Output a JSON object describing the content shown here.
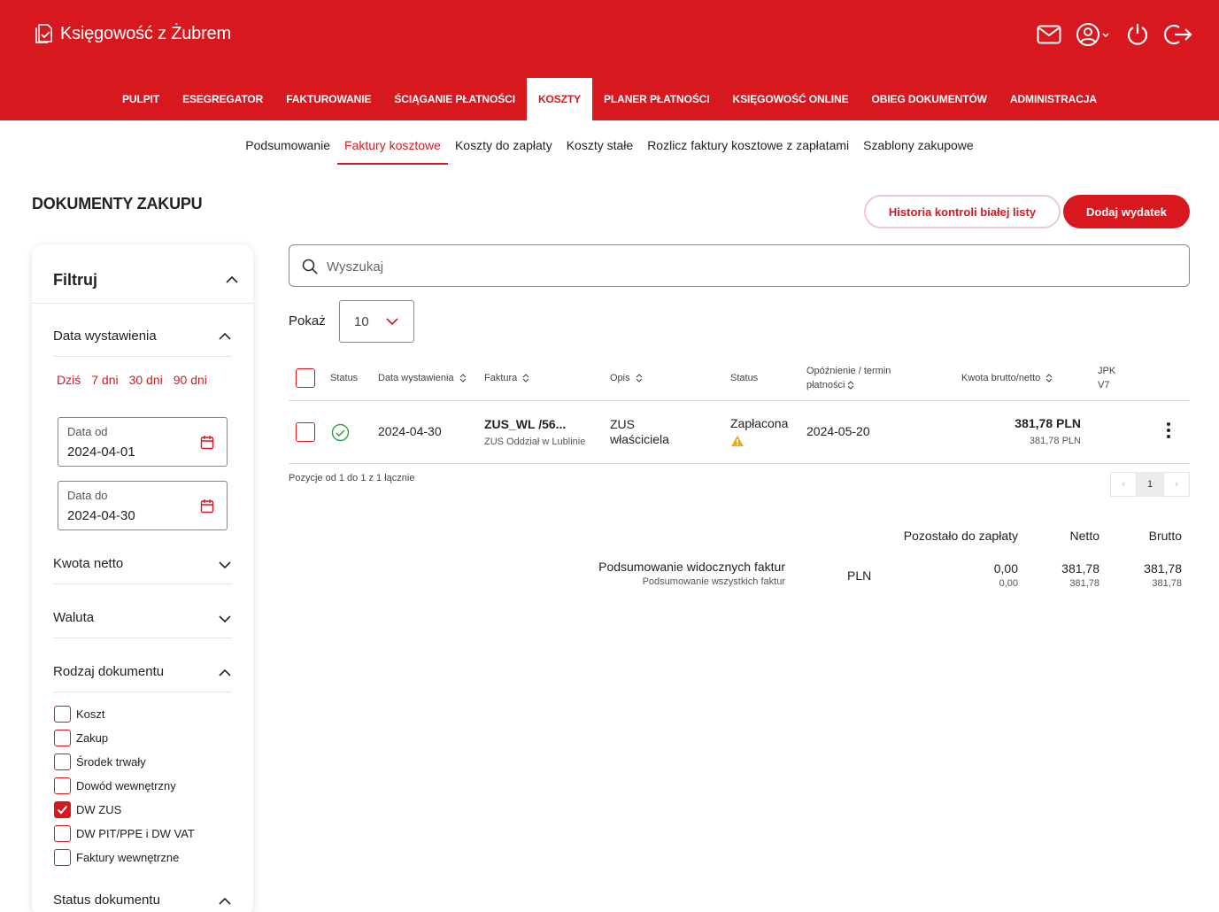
{
  "app": {
    "name": "Księgowość z Żubrem"
  },
  "header_icons": [
    "mail-icon",
    "user-icon",
    "power-icon",
    "logout-icon"
  ],
  "main_nav": [
    {
      "label": "PULPIT"
    },
    {
      "label": "ESEGREGATOR"
    },
    {
      "label": "FAKTUROWANIE"
    },
    {
      "label": "ŚCIĄGANIE PŁATNOŚCI"
    },
    {
      "label": "KOSZTY",
      "active": true
    },
    {
      "label": "PLANER PŁATNOŚCI"
    },
    {
      "label": "KSIĘGOWOŚĆ ONLINE"
    },
    {
      "label": "OBIEG DOKUMENTÓW"
    },
    {
      "label": "ADMINISTRACJA"
    }
  ],
  "sub_nav": [
    {
      "label": "Podsumowanie"
    },
    {
      "label": "Faktury kosztowe",
      "active": true
    },
    {
      "label": "Koszty do zapłaty"
    },
    {
      "label": "Koszty stałe"
    },
    {
      "label": "Rozlicz faktury kosztowe z zapłatami"
    },
    {
      "label": "Szablony zakupowe"
    }
  ],
  "page": {
    "title": "DOKUMENTY ZAKUPU",
    "btn_history": "Historia kontroli białej listy",
    "btn_add": "Dodaj wydatek"
  },
  "filter": {
    "title": "Filtruj",
    "date_section": "Data wystawienia",
    "quick": [
      "Dziś",
      "7 dni",
      "30 dni",
      "90 dni"
    ],
    "date_from_label": "Data od",
    "date_from": "2024-04-01",
    "date_to_label": "Data do",
    "date_to": "2024-04-30",
    "amount_section": "Kwota netto",
    "currency_section": "Waluta",
    "doctype_section": "Rodzaj dokumentu",
    "doctypes": [
      {
        "label": "Koszt",
        "checked": false
      },
      {
        "label": "Zakup",
        "checked": false
      },
      {
        "label": "Środek trwały",
        "checked": false
      },
      {
        "label": "Dowód wewnętrzny",
        "checked": false
      },
      {
        "label": "DW ZUS",
        "checked": true
      },
      {
        "label": "DW PIT/PPE i DW VAT",
        "checked": false
      },
      {
        "label": "Faktury wewnętrzne",
        "checked": false
      }
    ],
    "status_section": "Status dokumentu"
  },
  "search": {
    "placeholder": "Wyszukaj"
  },
  "page_size": {
    "label": "Pokaż",
    "value": "10"
  },
  "table": {
    "headers": {
      "status": "Status",
      "date": "Data wystawienia",
      "invoice": "Faktura",
      "desc": "Opis",
      "status2": "Status",
      "delay_1": "Opóźnienie / termin",
      "delay_2": "płatności",
      "amount": "Kwota brutto/netto",
      "jpk_1": "JPK",
      "jpk_2": "V7"
    },
    "rows": [
      {
        "date": "2024-04-30",
        "invoice": "ZUS_WL /56...",
        "issuer": "ZUS Oddział w Lublinie",
        "desc_1": "ZUS",
        "desc_2": "właściciela",
        "status": "Zapłacona",
        "due": "2024-05-20",
        "gross": "381,78 PLN",
        "net": "381,78 PLN"
      }
    ],
    "info": "Pozycje od 1 do 1 z 1 łącznie",
    "pager": {
      "prev": "‹",
      "current": "1",
      "next": "›"
    }
  },
  "summary": {
    "col_remaining": "Pozostało do zapłaty",
    "col_net": "Netto",
    "col_gross": "Brutto",
    "visible_label": "Podsumowanie widocznych faktur",
    "all_label": "Podsumowanie wszystkich faktur",
    "currency": "PLN",
    "visible_remaining": "0,00",
    "all_remaining": "0,00",
    "visible_net": "381,78",
    "all_net": "381,78",
    "visible_gross": "381,78",
    "all_gross": "381,78"
  },
  "colors": {
    "brand": "#d7191f",
    "paid": "#2e9e3e",
    "warning": "#f0a818"
  }
}
